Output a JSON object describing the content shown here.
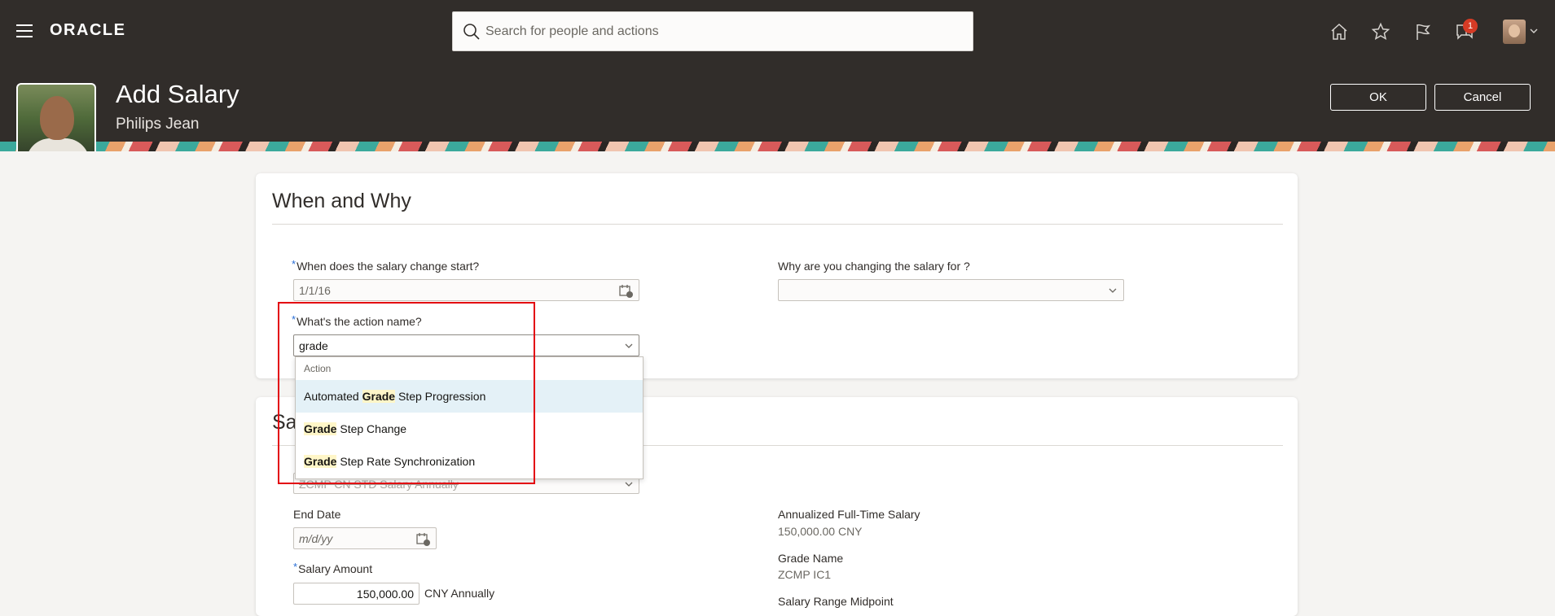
{
  "topbar": {
    "logo": "ORACLE",
    "search_placeholder": "Search for people and actions",
    "notification_count": "1",
    "icons": [
      "menu-icon",
      "home-icon",
      "star-icon",
      "flag-icon",
      "notifications-icon",
      "user-avatar",
      "chevron-down-icon"
    ]
  },
  "header": {
    "title": "Add Salary",
    "subtitle": "Philips Jean",
    "ok_label": "OK",
    "cancel_label": "Cancel"
  },
  "when_why": {
    "section_title": "When and Why",
    "start_label": "When does the salary change start?",
    "start_value": "1/1/16",
    "reason_label": "Why are you changing the salary for ?",
    "reason_value": "",
    "action_label": "What's the action name?",
    "action_value": "grade"
  },
  "dropdown": {
    "header": "Action",
    "items": [
      {
        "pre": "Automated ",
        "match": "Grade",
        "post": " Step Progression"
      },
      {
        "pre": "",
        "match": "Grade",
        "post": " Step Change"
      },
      {
        "pre": "",
        "match": "Grade",
        "post": " Step Rate Synchronization"
      }
    ]
  },
  "salary": {
    "section_title_partial": "Sa",
    "basis_value": "ZCMP CN STD Salary Annually",
    "end_date_label": "End Date",
    "end_date_placeholder": "m/d/yy",
    "amount_label": "Salary Amount",
    "amount_value": "150,000.00",
    "amount_unit": "CNY Annually",
    "annualized_label": "Annualized Full-Time Salary",
    "annualized_value": "150,000.00 CNY",
    "grade_label": "Grade Name",
    "grade_value": "ZCMP IC1",
    "midpoint_label": "Salary Range Midpoint"
  },
  "colors": {
    "header_bg": "#312d2a",
    "highlight_row": "#e4f1f7",
    "annotation_box": "#e3000f",
    "required_marker": "#2a6fd6"
  }
}
